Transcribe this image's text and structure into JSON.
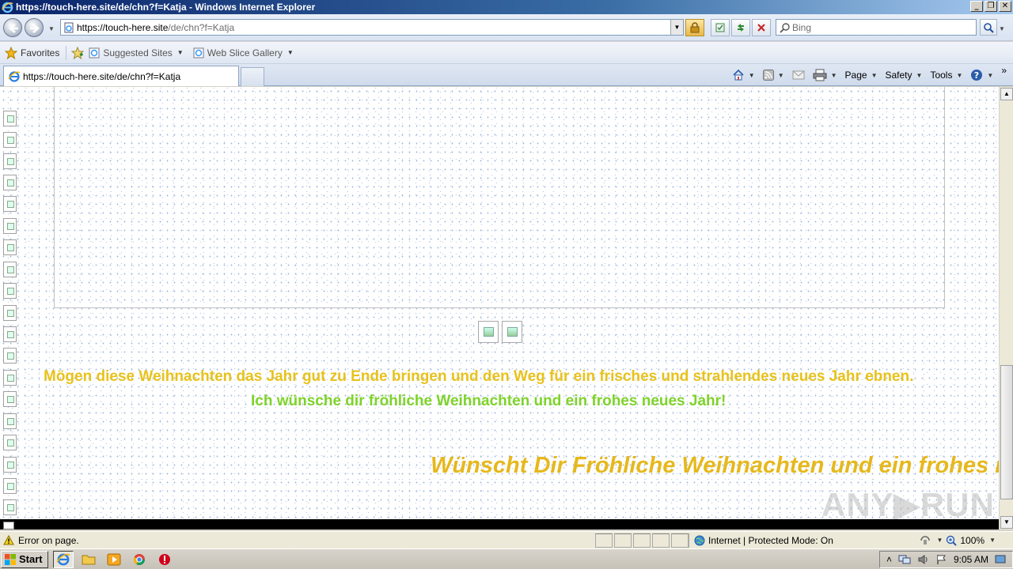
{
  "window": {
    "title": "https://touch-here.site/de/chn?f=Katja - Windows Internet Explorer",
    "min_glyph": "_",
    "max_glyph": "❐",
    "close_glyph": "✕"
  },
  "address_bar": {
    "url_host": "https://touch-here.site",
    "url_path": "/de/chn?f=Katja",
    "search_placeholder": "Bing"
  },
  "favorites_bar": {
    "favorites_label": "Favorites",
    "suggested_sites_label": "Suggested Sites",
    "web_slice_label": "Web Slice Gallery"
  },
  "tabs": [
    {
      "label": "https://touch-here.site/de/chn?f=Katja",
      "active": true
    }
  ],
  "command_bar": {
    "page_label": "Page",
    "safety_label": "Safety",
    "tools_label": "Tools",
    "more_glyph": "»"
  },
  "content": {
    "line1": "Mögen diese Weihnachten das Jahr gut zu Ende bringen und den Weg für ein frisches und strahlendes neues Jahr ebnen.",
    "line2": "Ich wünsche dir fröhliche Weihnachten und ein frohes neues Jahr!",
    "line3": "Wünscht Dir Fröhliche Weihnachten und ein frohes neues Jahr",
    "watermark": "ANY▶RUN",
    "colors": {
      "line1": "#e8c21a",
      "line2": "#7ed32a",
      "line3": "#e6b81c"
    }
  },
  "status_bar": {
    "message": "Error on page.",
    "zone": "Internet | Protected Mode: On",
    "zoom": "100%"
  },
  "taskbar": {
    "start_label": "Start",
    "clock": "9:05 AM"
  }
}
